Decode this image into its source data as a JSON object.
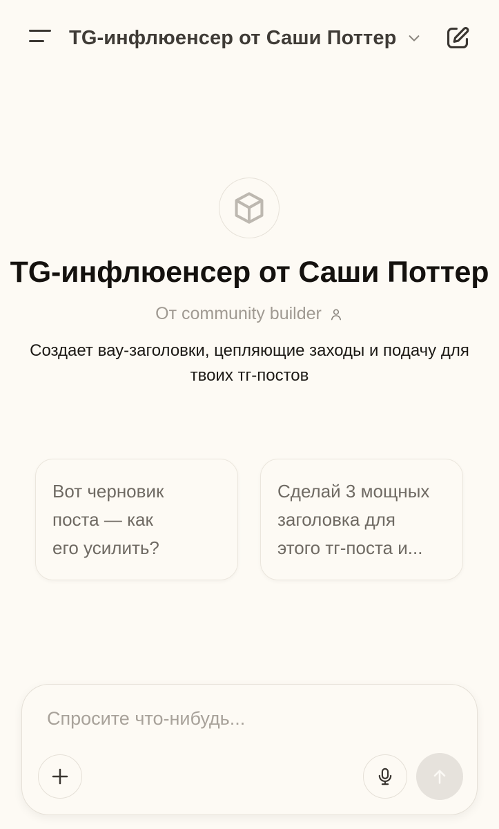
{
  "header": {
    "menu_icon": "hamburger-menu-icon",
    "title": "TG-инфлюенсер от Саши Поттер",
    "chevron_icon": "chevron-down-icon",
    "edit_icon": "new-chat-edit-icon"
  },
  "gpt": {
    "avatar_icon": "cube-icon",
    "name": "TG-инфлюенсер от Саши Поттер",
    "author": "От community builder",
    "author_icon": "person-icon",
    "description_lines": [
      "Создает вау-заголовки, цепляющие заходы и подачу для",
      "твоих тг-постов"
    ]
  },
  "suggestions": [
    {
      "lines": [
        "Вот черновик",
        "поста — как",
        "его усилить?"
      ]
    },
    {
      "lines": [
        "Сделай 3 мощных",
        "заголовка для",
        "этого тг-поста и..."
      ]
    }
  ],
  "composer": {
    "placeholder": "Спросите что-нибудь...",
    "plus_icon": "plus-icon",
    "mic_icon": "microphone-icon",
    "send_icon": "arrow-up-icon"
  },
  "colors": {
    "background": "#fdfaf4",
    "text_primary": "#14110e",
    "text_muted": "#a09a92",
    "send_disabled": "#e6e2dc"
  }
}
